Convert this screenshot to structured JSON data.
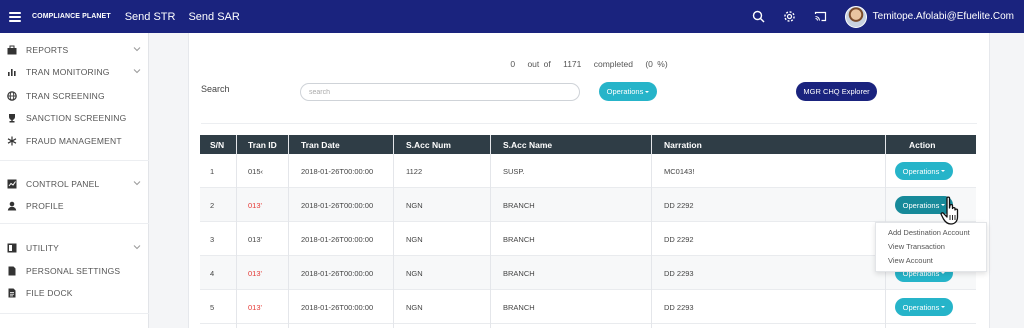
{
  "topbar": {
    "brand": "COMPLIANCE PLANET",
    "nav": [
      "Send STR",
      "Send SAR"
    ],
    "icons": [
      "search-icon",
      "gear-icon",
      "cast-icon"
    ],
    "username": "Temitope.Afolabi@Efuelite.Com"
  },
  "sidebar": {
    "items": [
      {
        "label": "REPORTS",
        "icon": "briefcase-icon",
        "chevron": true
      },
      {
        "label": "TRAN MONITORING",
        "icon": "bar-chart-icon",
        "chevron": true
      },
      {
        "label": "TRAN SCREENING",
        "icon": "globe-icon",
        "chevron": false
      },
      {
        "label": "SANCTION SCREENING",
        "icon": "trophy-icon",
        "chevron": false
      },
      {
        "label": "FRAUD MANAGEMENT",
        "icon": "snowflake-icon",
        "chevron": false
      },
      {
        "label": "CONTROL PANEL",
        "icon": "line-chart-icon",
        "chevron": true
      },
      {
        "label": "PROFILE",
        "icon": "user-icon",
        "chevron": false
      },
      {
        "label": "UTILITY",
        "icon": "tablet-icon",
        "chevron": true
      },
      {
        "label": "PERSONAL SETTINGS",
        "icon": "file-icon",
        "chevron": false
      },
      {
        "label": "FILE DOCK",
        "icon": "file-text-icon",
        "chevron": false
      }
    ]
  },
  "progress": {
    "done": "0",
    "out_of": "out of",
    "total": "1171",
    "completed": "completed",
    "percent": "(0 %)"
  },
  "search": {
    "label": "Search",
    "placeholder": "search",
    "value": ""
  },
  "buttons": {
    "operations": "Operations",
    "mgr": "MGR CHQ Explorer"
  },
  "table": {
    "columns": [
      "S/N",
      "Tran ID",
      "Tran Date",
      "S.Acc Num",
      "S.Acc Name",
      "Narration",
      "Action"
    ],
    "rows": [
      {
        "sn": "1",
        "tran_id": "015‹",
        "tran_id_color": "#444444",
        "date": "2018-01-26T00:00:00",
        "acc_num": "1122",
        "acc_name": "SUSP.",
        "narration": "MC0143!",
        "action": "Operations"
      },
      {
        "sn": "2",
        "tran_id": "013'",
        "tran_id_color": "#e53935",
        "date": "2018-01-26T00:00:00",
        "acc_num": "NGN",
        "acc_name": "BRANCH",
        "narration": "DD 2292",
        "action": "Operations"
      },
      {
        "sn": "3",
        "tran_id": "013'",
        "tran_id_color": "#444444",
        "date": "2018-01-26T00:00:00",
        "acc_num": "NGN",
        "acc_name": "BRANCH",
        "narration": "DD 2292",
        "action": ""
      },
      {
        "sn": "4",
        "tran_id": "013'",
        "tran_id_color": "#e53935",
        "date": "2018-01-26T00:00:00",
        "acc_num": "NGN",
        "acc_name": "BRANCH",
        "narration": "DD 2293",
        "action": "Operations"
      },
      {
        "sn": "5",
        "tran_id": "013'",
        "tran_id_color": "#e53935",
        "date": "2018-01-26T00:00:00",
        "acc_num": "NGN",
        "acc_name": "BRANCH",
        "narration": "DD 2293",
        "action": "Operations"
      }
    ]
  },
  "dropdown": {
    "items": [
      "Add Destination Account",
      "View Transaction",
      "View Account"
    ]
  },
  "colors": {
    "topbar": "#1a237e",
    "accent": "#26b4c9",
    "table_header": "#2f3d46",
    "highlight_id": "#e53935"
  }
}
